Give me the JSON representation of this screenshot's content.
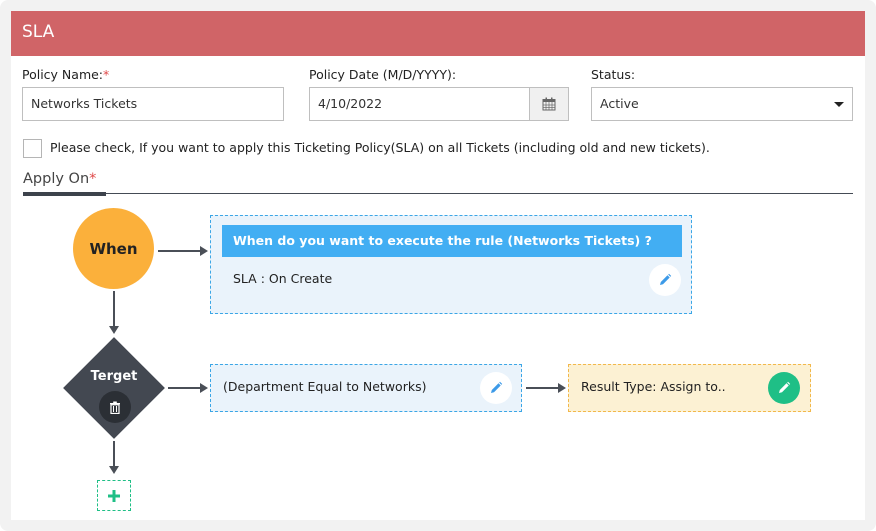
{
  "header": {
    "title": "SLA"
  },
  "form": {
    "policy_name": {
      "label": "Policy Name:",
      "required_mark": "*",
      "value": "Networks Tickets"
    },
    "policy_date": {
      "label": "Policy Date (M/D/YYYY):",
      "value": "4/10/2022",
      "icon": "calendar-icon"
    },
    "status": {
      "label": "Status:",
      "value": "Active",
      "icon": "caret-down-icon"
    },
    "apply_all": {
      "checked": false,
      "label": "Please check, If you want to apply this Ticketing Policy(SLA) on all Tickets (including old and new tickets)."
    }
  },
  "apply_on": {
    "title": "Apply On",
    "required_mark": "*",
    "when_node": {
      "label": "When"
    },
    "when_box": {
      "heading": "When do you want to execute the rule (Networks Tickets) ?",
      "text": "SLA : On Create",
      "icon": "pencil-icon"
    },
    "target_node": {
      "label": "Terget",
      "icon": "trash-icon"
    },
    "condition_box": {
      "text": "(Department Equal to Networks)",
      "icon": "pencil-icon"
    },
    "result_box": {
      "text": "Result Type: Assign to..",
      "icon": "pencil-icon"
    },
    "add_button": {
      "icon": "plus-icon"
    }
  },
  "colors": {
    "header": "#d06467",
    "when_node": "#fbb03b",
    "target_node": "#434851",
    "accent_blue": "#42aef3",
    "accent_green": "#1fbf86",
    "result_bg": "#fcf1d3"
  }
}
